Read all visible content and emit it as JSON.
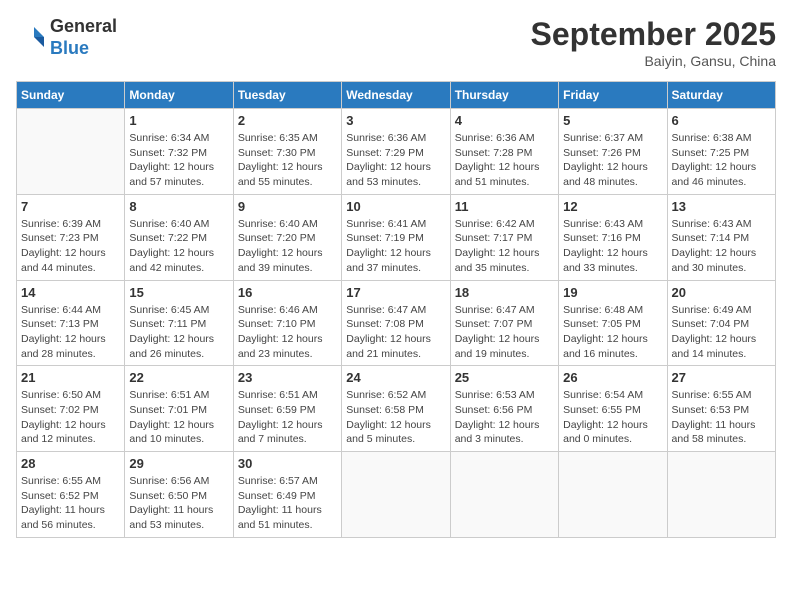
{
  "header": {
    "logo_general": "General",
    "logo_blue": "Blue",
    "month_title": "September 2025",
    "location": "Baiyin, Gansu, China"
  },
  "days_of_week": [
    "Sunday",
    "Monday",
    "Tuesday",
    "Wednesday",
    "Thursday",
    "Friday",
    "Saturday"
  ],
  "weeks": [
    [
      {
        "day": "",
        "info": ""
      },
      {
        "day": "1",
        "info": "Sunrise: 6:34 AM\nSunset: 7:32 PM\nDaylight: 12 hours\nand 57 minutes."
      },
      {
        "day": "2",
        "info": "Sunrise: 6:35 AM\nSunset: 7:30 PM\nDaylight: 12 hours\nand 55 minutes."
      },
      {
        "day": "3",
        "info": "Sunrise: 6:36 AM\nSunset: 7:29 PM\nDaylight: 12 hours\nand 53 minutes."
      },
      {
        "day": "4",
        "info": "Sunrise: 6:36 AM\nSunset: 7:28 PM\nDaylight: 12 hours\nand 51 minutes."
      },
      {
        "day": "5",
        "info": "Sunrise: 6:37 AM\nSunset: 7:26 PM\nDaylight: 12 hours\nand 48 minutes."
      },
      {
        "day": "6",
        "info": "Sunrise: 6:38 AM\nSunset: 7:25 PM\nDaylight: 12 hours\nand 46 minutes."
      }
    ],
    [
      {
        "day": "7",
        "info": "Sunrise: 6:39 AM\nSunset: 7:23 PM\nDaylight: 12 hours\nand 44 minutes."
      },
      {
        "day": "8",
        "info": "Sunrise: 6:40 AM\nSunset: 7:22 PM\nDaylight: 12 hours\nand 42 minutes."
      },
      {
        "day": "9",
        "info": "Sunrise: 6:40 AM\nSunset: 7:20 PM\nDaylight: 12 hours\nand 39 minutes."
      },
      {
        "day": "10",
        "info": "Sunrise: 6:41 AM\nSunset: 7:19 PM\nDaylight: 12 hours\nand 37 minutes."
      },
      {
        "day": "11",
        "info": "Sunrise: 6:42 AM\nSunset: 7:17 PM\nDaylight: 12 hours\nand 35 minutes."
      },
      {
        "day": "12",
        "info": "Sunrise: 6:43 AM\nSunset: 7:16 PM\nDaylight: 12 hours\nand 33 minutes."
      },
      {
        "day": "13",
        "info": "Sunrise: 6:43 AM\nSunset: 7:14 PM\nDaylight: 12 hours\nand 30 minutes."
      }
    ],
    [
      {
        "day": "14",
        "info": "Sunrise: 6:44 AM\nSunset: 7:13 PM\nDaylight: 12 hours\nand 28 minutes."
      },
      {
        "day": "15",
        "info": "Sunrise: 6:45 AM\nSunset: 7:11 PM\nDaylight: 12 hours\nand 26 minutes."
      },
      {
        "day": "16",
        "info": "Sunrise: 6:46 AM\nSunset: 7:10 PM\nDaylight: 12 hours\nand 23 minutes."
      },
      {
        "day": "17",
        "info": "Sunrise: 6:47 AM\nSunset: 7:08 PM\nDaylight: 12 hours\nand 21 minutes."
      },
      {
        "day": "18",
        "info": "Sunrise: 6:47 AM\nSunset: 7:07 PM\nDaylight: 12 hours\nand 19 minutes."
      },
      {
        "day": "19",
        "info": "Sunrise: 6:48 AM\nSunset: 7:05 PM\nDaylight: 12 hours\nand 16 minutes."
      },
      {
        "day": "20",
        "info": "Sunrise: 6:49 AM\nSunset: 7:04 PM\nDaylight: 12 hours\nand 14 minutes."
      }
    ],
    [
      {
        "day": "21",
        "info": "Sunrise: 6:50 AM\nSunset: 7:02 PM\nDaylight: 12 hours\nand 12 minutes."
      },
      {
        "day": "22",
        "info": "Sunrise: 6:51 AM\nSunset: 7:01 PM\nDaylight: 12 hours\nand 10 minutes."
      },
      {
        "day": "23",
        "info": "Sunrise: 6:51 AM\nSunset: 6:59 PM\nDaylight: 12 hours\nand 7 minutes."
      },
      {
        "day": "24",
        "info": "Sunrise: 6:52 AM\nSunset: 6:58 PM\nDaylight: 12 hours\nand 5 minutes."
      },
      {
        "day": "25",
        "info": "Sunrise: 6:53 AM\nSunset: 6:56 PM\nDaylight: 12 hours\nand 3 minutes."
      },
      {
        "day": "26",
        "info": "Sunrise: 6:54 AM\nSunset: 6:55 PM\nDaylight: 12 hours\nand 0 minutes."
      },
      {
        "day": "27",
        "info": "Sunrise: 6:55 AM\nSunset: 6:53 PM\nDaylight: 11 hours\nand 58 minutes."
      }
    ],
    [
      {
        "day": "28",
        "info": "Sunrise: 6:55 AM\nSunset: 6:52 PM\nDaylight: 11 hours\nand 56 minutes."
      },
      {
        "day": "29",
        "info": "Sunrise: 6:56 AM\nSunset: 6:50 PM\nDaylight: 11 hours\nand 53 minutes."
      },
      {
        "day": "30",
        "info": "Sunrise: 6:57 AM\nSunset: 6:49 PM\nDaylight: 11 hours\nand 51 minutes."
      },
      {
        "day": "",
        "info": ""
      },
      {
        "day": "",
        "info": ""
      },
      {
        "day": "",
        "info": ""
      },
      {
        "day": "",
        "info": ""
      }
    ]
  ]
}
